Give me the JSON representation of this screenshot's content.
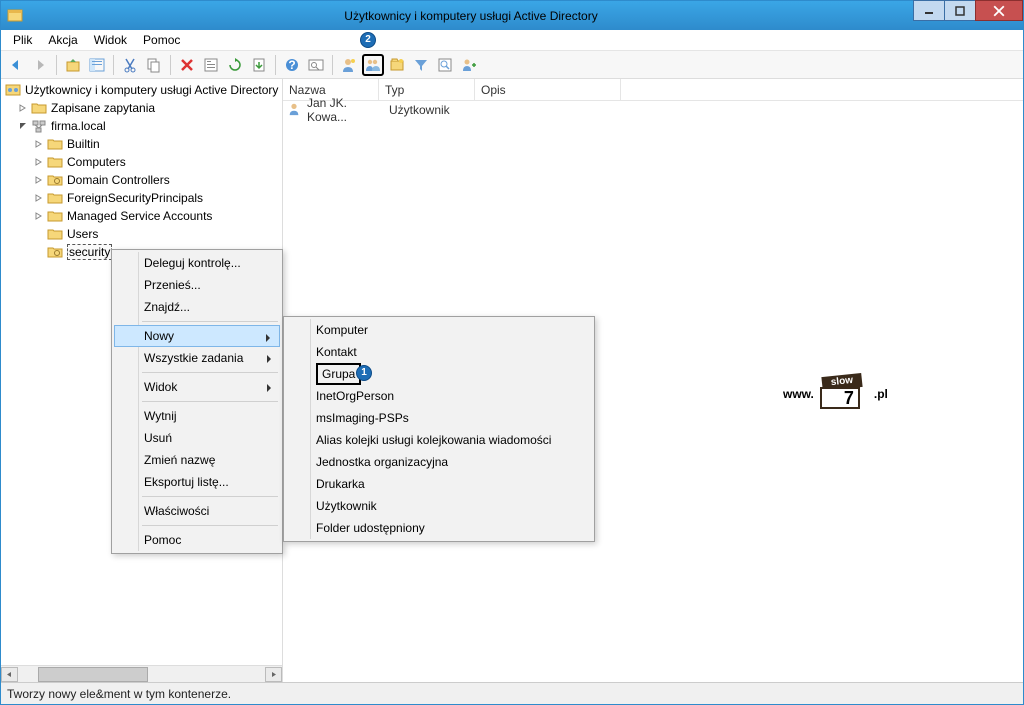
{
  "window": {
    "title": "Użytkownicy i komputery usługi Active Directory"
  },
  "menubar": {
    "file": "Plik",
    "action": "Akcja",
    "view": "Widok",
    "help": "Pomoc"
  },
  "badges": {
    "one": "1",
    "two": "2"
  },
  "tree": {
    "root": "Użytkownicy i komputery usługi Active Directory",
    "saved_queries": "Zapisane zapytania",
    "domain": "firma.local",
    "builtin": "Builtin",
    "computers": "Computers",
    "dc": "Domain Controllers",
    "fsp": "ForeignSecurityPrincipals",
    "msa": "Managed Service Accounts",
    "users": "Users",
    "security": "security"
  },
  "list": {
    "columns": {
      "name": "Nazwa",
      "type": "Typ",
      "desc": "Opis"
    },
    "rows": [
      {
        "name": "Jan JK. Kowa...",
        "type": "Użytkownik",
        "desc": ""
      }
    ]
  },
  "context_main": {
    "delegate": "Deleguj kontrolę...",
    "move": "Przenieś...",
    "find": "Znajdź...",
    "new": "Nowy",
    "all_tasks": "Wszystkie zadania",
    "view": "Widok",
    "cut": "Wytnij",
    "delete": "Usuń",
    "rename": "Zmień nazwę",
    "export": "Eksportuj listę...",
    "properties": "Właściwości",
    "help": "Pomoc"
  },
  "context_sub": {
    "computer": "Komputer",
    "contact": "Kontakt",
    "group": "Grupa",
    "inetorg": "InetOrgPerson",
    "msimaging": "msImaging-PSPs",
    "msmq_alias": "Alias kolejki usługi kolejkowania wiadomości",
    "ou": "Jednostka organizacyjna",
    "printer": "Drukarka",
    "user": "Użytkownik",
    "shared_folder": "Folder udostępniony"
  },
  "watermark": {
    "prefix": "www.",
    "logo_top": "slow",
    "logo_num": "7",
    "suffix": ".pl"
  },
  "statusbar": {
    "text": "Tworzy nowy ele&ment w tym kontenerze."
  }
}
